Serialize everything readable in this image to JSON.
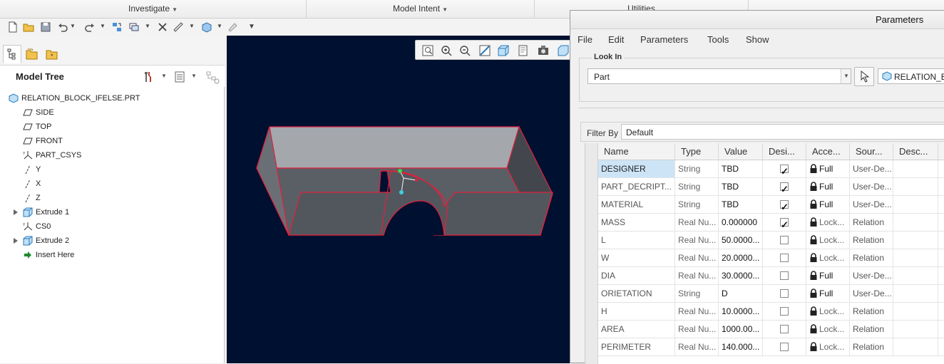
{
  "ribbon": {
    "groups": [
      {
        "label": "Investigate",
        "dropdown": true
      },
      {
        "label": "Model Intent",
        "dropdown": true
      },
      {
        "label": "Utilities",
        "dropdown": false
      }
    ]
  },
  "model_tree": {
    "title": "Model Tree",
    "items": [
      {
        "label": "RELATION_BLOCK_IFELSE.PRT",
        "icon": "part-icon"
      },
      {
        "label": "SIDE",
        "icon": "datum-plane-icon"
      },
      {
        "label": "TOP",
        "icon": "datum-plane-icon"
      },
      {
        "label": "FRONT",
        "icon": "datum-plane-icon"
      },
      {
        "label": "PART_CSYS",
        "icon": "csys-icon"
      },
      {
        "label": "Y",
        "icon": "axis-icon"
      },
      {
        "label": "X",
        "icon": "axis-icon"
      },
      {
        "label": "Z",
        "icon": "axis-icon"
      },
      {
        "label": "Extrude 1",
        "icon": "extrude-icon"
      },
      {
        "label": "CS0",
        "icon": "csys-icon"
      },
      {
        "label": "Extrude 2",
        "icon": "extrude-icon"
      },
      {
        "label": "Insert Here",
        "icon": "insert-arrow-icon"
      }
    ]
  },
  "parameters": {
    "title": "Parameters",
    "menu": [
      "File",
      "Edit",
      "Parameters",
      "Tools",
      "Show"
    ],
    "look_in_label": "Look In",
    "look_in_value": "Part",
    "model_name": "RELATION_B",
    "filter_label": "Filter By",
    "filter_value": "Default",
    "columns": [
      "Name",
      "Type",
      "Value",
      "Desi...",
      "Acce...",
      "Sour...",
      "Desc...",
      ""
    ],
    "rows": [
      {
        "name": "DESIGNER",
        "type": "String",
        "value": "TBD",
        "designated": true,
        "access": "Full",
        "source": "User-De...",
        "selected": true
      },
      {
        "name": "PART_DECRIPT...",
        "type": "String",
        "value": "TBD",
        "designated": true,
        "access": "Full",
        "source": "User-De..."
      },
      {
        "name": "MATERIAL",
        "type": "String",
        "value": "TBD",
        "designated": true,
        "access": "Full",
        "source": "User-De..."
      },
      {
        "name": "MASS",
        "type": "Real Nu...",
        "value": "0.000000",
        "designated": true,
        "access": "Lock...",
        "source": "Relation"
      },
      {
        "name": "L",
        "type": "Real Nu...",
        "value": "50.0000...",
        "designated": false,
        "access": "Lock...",
        "source": "Relation"
      },
      {
        "name": "W",
        "type": "Real Nu...",
        "value": "20.0000...",
        "designated": false,
        "access": "Lock...",
        "source": "Relation"
      },
      {
        "name": "DIA",
        "type": "Real Nu...",
        "value": "30.0000...",
        "designated": false,
        "access": "Full",
        "source": "User-De..."
      },
      {
        "name": "ORIETATION",
        "type": "String",
        "value": "D",
        "designated": false,
        "access": "Full",
        "source": "User-De..."
      },
      {
        "name": "H",
        "type": "Real Nu...",
        "value": "10.0000...",
        "designated": false,
        "access": "Lock...",
        "source": "Relation"
      },
      {
        "name": "AREA",
        "type": "Real Nu...",
        "value": "1000.00...",
        "designated": false,
        "access": "Lock...",
        "source": "Relation"
      },
      {
        "name": "PERIMETER",
        "type": "Real Nu...",
        "value": "140.000...",
        "designated": false,
        "access": "Lock...",
        "source": "Relation"
      }
    ]
  },
  "colors": {
    "viewport_bg": "#001030",
    "model_face": "#5a5f66",
    "model_top": "#a4a8ad",
    "edge": "#e0203c",
    "selection": "#cde4f7"
  }
}
